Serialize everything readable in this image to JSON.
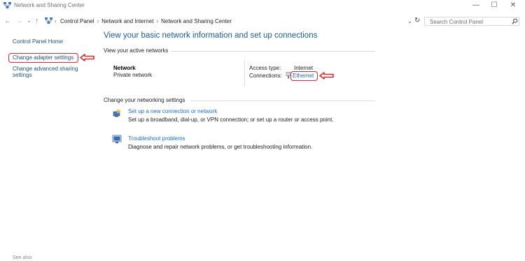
{
  "window": {
    "title": "Network and Sharing Center",
    "minimize": "—",
    "maximize": "☐",
    "close": "✕"
  },
  "navigation": {
    "back": "←",
    "forward": "→",
    "recent": "⌄",
    "up": "↑",
    "breadcrumb": [
      "Control Panel",
      "Network and Internet",
      "Network and Sharing Center"
    ],
    "refresh": "↻",
    "search_placeholder": "Search Control Panel"
  },
  "left_pane": {
    "home": "Control Panel Home",
    "change_adapter": "Change adapter settings",
    "change_advanced_line1": "Change advanced sharing",
    "change_advanced_line2": "settings",
    "see_also": "See also"
  },
  "main": {
    "title": "View your basic network information and set up connections",
    "active_networks_label": "View your active networks",
    "network_name": "Network",
    "network_type": "Private network",
    "access_type_label": "Access type:",
    "access_type_value": "Internet",
    "connections_label": "Connections:",
    "connection_name": "Ethernet",
    "change_settings_label": "Change your networking settings",
    "tasks": [
      {
        "title": "Set up a new connection or network",
        "desc": "Set up a broadband, dial-up, or VPN connection; or set up a router or access point."
      },
      {
        "title": "Troubleshoot problems",
        "desc": "Diagnose and repair network problems, or get troubleshooting information."
      }
    ]
  },
  "annotation": {
    "color": "#d92b2b"
  }
}
